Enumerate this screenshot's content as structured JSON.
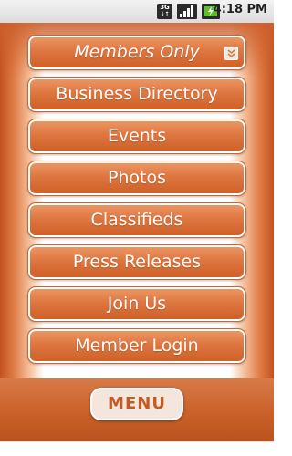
{
  "status_bar": {
    "network_label": "3G",
    "time": "4:18",
    "time_suffix": "PM",
    "icons": [
      "network-3g-icon",
      "signal-strength-icon",
      "battery-charging-icon"
    ]
  },
  "menu": {
    "items": [
      {
        "label": "Members Only",
        "style": "italic",
        "has_dropdown": true
      },
      {
        "label": "Business Directory"
      },
      {
        "label": "Events"
      },
      {
        "label": "Photos"
      },
      {
        "label": "Classifieds"
      },
      {
        "label": "Press Releases"
      },
      {
        "label": "Join Us"
      },
      {
        "label": "Member Login"
      }
    ]
  },
  "bottom_bar": {
    "menu_label": "MENU"
  },
  "colors": {
    "accent": "#de7640",
    "accent_dark": "#c25a22",
    "menu_button_bg": "#f4e6dc"
  }
}
